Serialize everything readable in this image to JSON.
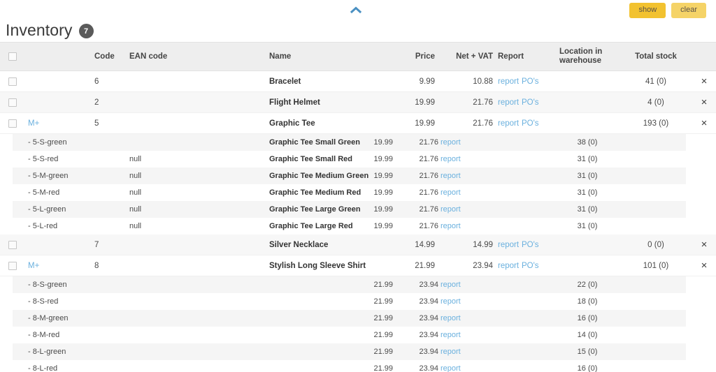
{
  "topbar": {
    "collapse_icon": "chevron-up-icon",
    "show_label": "show",
    "clear_label": "clear",
    "show_color": "#f2c230",
    "clear_color": "#f5d367"
  },
  "page": {
    "title": "Inventory",
    "count": "7"
  },
  "table": {
    "headers": {
      "code": "Code",
      "ean": "EAN code",
      "name": "Name",
      "price": "Price",
      "net_vat": "Net + VAT",
      "report": "Report",
      "location_line1": "Location in",
      "location_line2": "warehouse",
      "total_stock": "Total stock"
    },
    "links": {
      "report": "report",
      "pos": "PO's",
      "expand": "M+",
      "remove": "×"
    },
    "rows": [
      {
        "type": "parent",
        "mplus": "",
        "code": "6",
        "ean": "",
        "name": "Bracelet",
        "price": "9.99",
        "net_vat": "10.88",
        "report": "report",
        "pos": "PO's",
        "location": "",
        "total_stock": "41 (0)"
      },
      {
        "type": "parent",
        "mplus": "",
        "code": "2",
        "ean": "",
        "name": "Flight Helmet",
        "price": "19.99",
        "net_vat": "21.76",
        "report": "report",
        "pos": "PO's",
        "location": "",
        "total_stock": "4 (0)"
      },
      {
        "type": "parent",
        "mplus": "M+",
        "code": "5",
        "ean": "",
        "name": "Graphic Tee",
        "price": "19.99",
        "net_vat": "21.76",
        "report": "report",
        "pos": "PO's",
        "location": "",
        "total_stock": "193 (0)"
      },
      {
        "type": "sub",
        "label": "- 5-S-green",
        "ean": "",
        "name": "Graphic Tee Small Green",
        "price": "19.99",
        "net_vat": "21.76",
        "report": "report",
        "total_stock": "38 (0)"
      },
      {
        "type": "sub",
        "label": "- 5-S-red",
        "ean": "null",
        "name": "Graphic Tee Small Red",
        "price": "19.99",
        "net_vat": "21.76",
        "report": "report",
        "total_stock": "31 (0)"
      },
      {
        "type": "sub",
        "label": "- 5-M-green",
        "ean": "null",
        "name": "Graphic Tee Medium Green",
        "price": "19.99",
        "net_vat": "21.76",
        "report": "report",
        "total_stock": "31 (0)"
      },
      {
        "type": "sub",
        "label": "- 5-M-red",
        "ean": "null",
        "name": "Graphic Tee Medium Red",
        "price": "19.99",
        "net_vat": "21.76",
        "report": "report",
        "total_stock": "31 (0)"
      },
      {
        "type": "sub",
        "label": "- 5-L-green",
        "ean": "null",
        "name": "Graphic Tee Large Green",
        "price": "19.99",
        "net_vat": "21.76",
        "report": "report",
        "total_stock": "31 (0)"
      },
      {
        "type": "sub",
        "label": "- 5-L-red",
        "ean": "null",
        "name": "Graphic Tee Large Red",
        "price": "19.99",
        "net_vat": "21.76",
        "report": "report",
        "total_stock": "31 (0)"
      },
      {
        "type": "parent",
        "mplus": "",
        "code": "7",
        "ean": "",
        "name": "Silver Necklace",
        "price": "14.99",
        "net_vat": "14.99",
        "report": "report",
        "pos": "PO's",
        "location": "",
        "total_stock": "0 (0)"
      },
      {
        "type": "parent",
        "mplus": "M+",
        "code": "8",
        "ean": "",
        "name": "Stylish Long Sleeve Shirt",
        "price": "21.99",
        "net_vat": "23.94",
        "report": "report",
        "pos": "PO's",
        "location": "",
        "total_stock": "101 (0)"
      },
      {
        "type": "sub",
        "label": "- 8-S-green",
        "ean": "",
        "name": "",
        "price": "21.99",
        "net_vat": "23.94",
        "report": "report",
        "total_stock": "22 (0)"
      },
      {
        "type": "sub",
        "label": "- 8-S-red",
        "ean": "",
        "name": "",
        "price": "21.99",
        "net_vat": "23.94",
        "report": "report",
        "total_stock": "18 (0)"
      },
      {
        "type": "sub",
        "label": "- 8-M-green",
        "ean": "",
        "name": "",
        "price": "21.99",
        "net_vat": "23.94",
        "report": "report",
        "total_stock": "16 (0)"
      },
      {
        "type": "sub",
        "label": "- 8-M-red",
        "ean": "",
        "name": "",
        "price": "21.99",
        "net_vat": "23.94",
        "report": "report",
        "total_stock": "14 (0)"
      },
      {
        "type": "sub",
        "label": "- 8-L-green",
        "ean": "",
        "name": "",
        "price": "21.99",
        "net_vat": "23.94",
        "report": "report",
        "total_stock": "15 (0)"
      },
      {
        "type": "sub",
        "label": "- 8-L-red",
        "ean": "",
        "name": "",
        "price": "21.99",
        "net_vat": "23.94",
        "report": "report",
        "total_stock": "16 (0)"
      }
    ]
  }
}
